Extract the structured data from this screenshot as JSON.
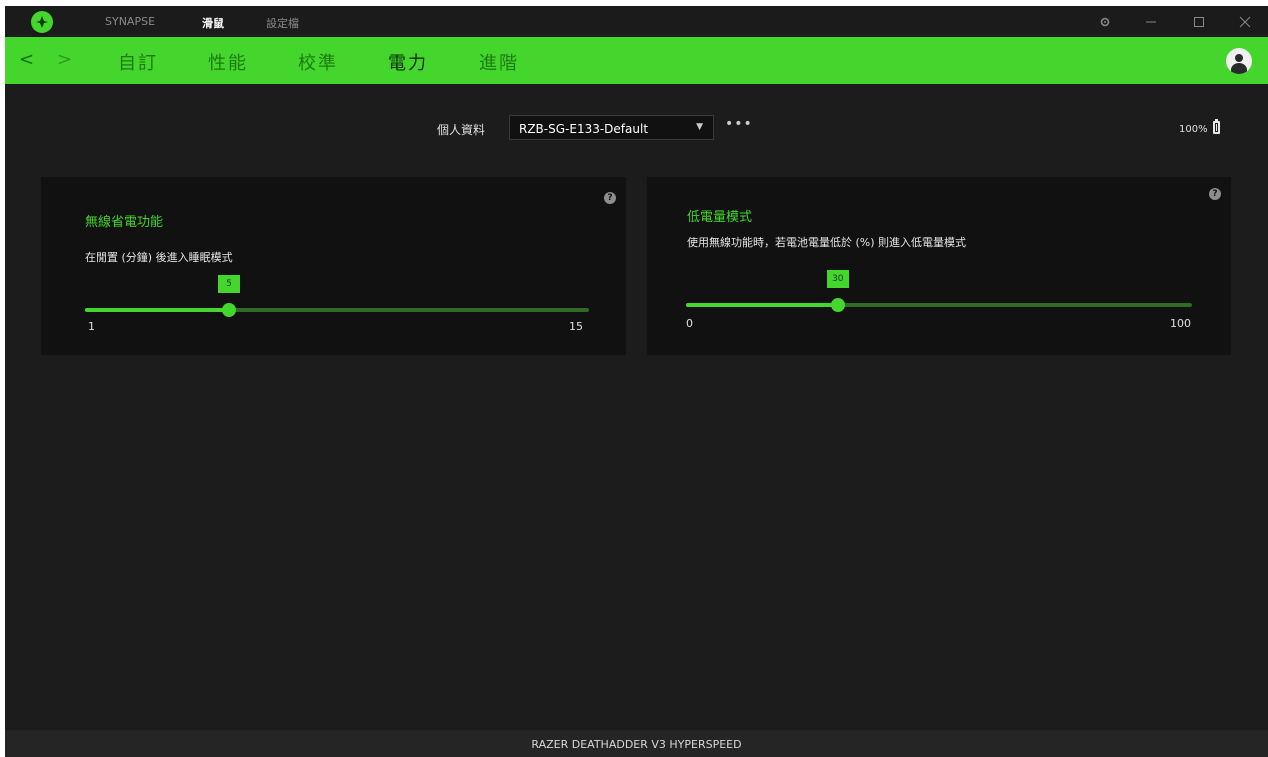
{
  "titlebar": {
    "tabs": [
      {
        "label": "SYNAPSE",
        "active": false
      },
      {
        "label": "滑鼠",
        "active": true
      },
      {
        "label": "設定檔",
        "active": false
      }
    ],
    "controls": [
      "gear-icon",
      "minimize-icon",
      "maximize-icon",
      "close-icon"
    ]
  },
  "nav": {
    "back": "<",
    "forward": ">",
    "tabs": [
      {
        "label": "自訂",
        "active": false
      },
      {
        "label": "性能",
        "active": false
      },
      {
        "label": "校準",
        "active": false
      },
      {
        "label": "電力",
        "active": true
      },
      {
        "label": "進階",
        "active": false
      }
    ]
  },
  "profile": {
    "label": "個人資料",
    "selected": "RZB-SG-E133-Default",
    "more": "•••"
  },
  "battery": {
    "text": "100%",
    "level_pct": 100
  },
  "cards": [
    {
      "title": "無線省電功能",
      "description": "在閒置 (分鐘) 後進入睡眠模式",
      "help": "?",
      "slider": {
        "min": 1,
        "max": 15,
        "value": 5,
        "min_label": "1",
        "max_label": "15",
        "value_label": "5"
      }
    },
    {
      "title": "低電量模式",
      "description": "使用無線功能時，若電池電量低於 (%) 則進入低電量模式",
      "help": "?",
      "slider": {
        "min": 0,
        "max": 100,
        "value": 30,
        "min_label": "0",
        "max_label": "100",
        "value_label": "30"
      }
    }
  ],
  "footer": {
    "device": "RAZER DEATHADDER V3 HYPERSPEED"
  },
  "colors": {
    "accent": "#44d62c",
    "background": "#1c1c1c",
    "card": "#111111"
  }
}
